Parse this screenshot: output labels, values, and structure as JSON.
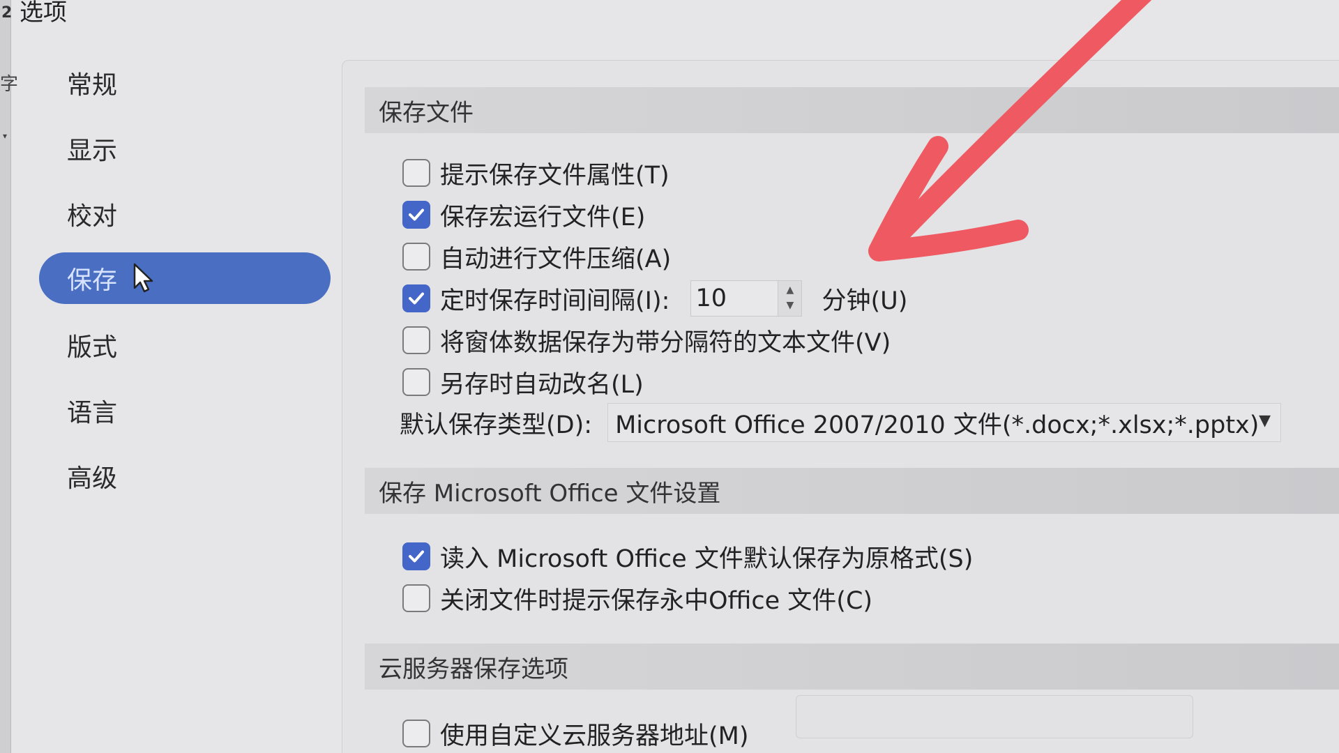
{
  "window": {
    "title": "选项",
    "edge_number": "2",
    "edge_char": "字"
  },
  "sidebar": {
    "items": [
      {
        "label": "常规",
        "active": false
      },
      {
        "label": "显示",
        "active": false
      },
      {
        "label": "校对",
        "active": false
      },
      {
        "label": "保存",
        "active": true
      },
      {
        "label": "版式",
        "active": false
      },
      {
        "label": "语言",
        "active": false
      },
      {
        "label": "高级",
        "active": false
      }
    ]
  },
  "save_file": {
    "header": "保存文件",
    "options": [
      {
        "label": "提示保存文件属性(T)",
        "checked": false
      },
      {
        "label": "保存宏运行文件(E)",
        "checked": true
      },
      {
        "label": "自动进行文件压缩(A)",
        "checked": false
      },
      {
        "label": "定时保存时间间隔(I):",
        "checked": true
      },
      {
        "label": "将窗体数据保存为带分隔符的文本文件(V)",
        "checked": false
      },
      {
        "label": "另存时自动改名(L)",
        "checked": false
      }
    ],
    "interval_value": "10",
    "interval_unit": "分钟(U)",
    "default_type_label": "默认保存类型(D):",
    "default_type_value": "Microsoft Office 2007/2010 文件(*.docx;*.xlsx;*.pptx)"
  },
  "ms_office": {
    "header": "保存 Microsoft Office 文件设置",
    "options": [
      {
        "label": "读入 Microsoft Office 文件默认保存为原格式(S)",
        "checked": true
      },
      {
        "label": "关闭文件时提示保存永中Office 文件(C)",
        "checked": false
      }
    ]
  },
  "cloud": {
    "header": "云服务器保存选项",
    "option": {
      "label": "使用自定义云服务器地址(M)",
      "checked": false
    },
    "address_value": ""
  },
  "colors": {
    "accent": "#4466c8",
    "active_nav": "#4a6fc2",
    "annotation_arrow": "#ef5a62"
  }
}
